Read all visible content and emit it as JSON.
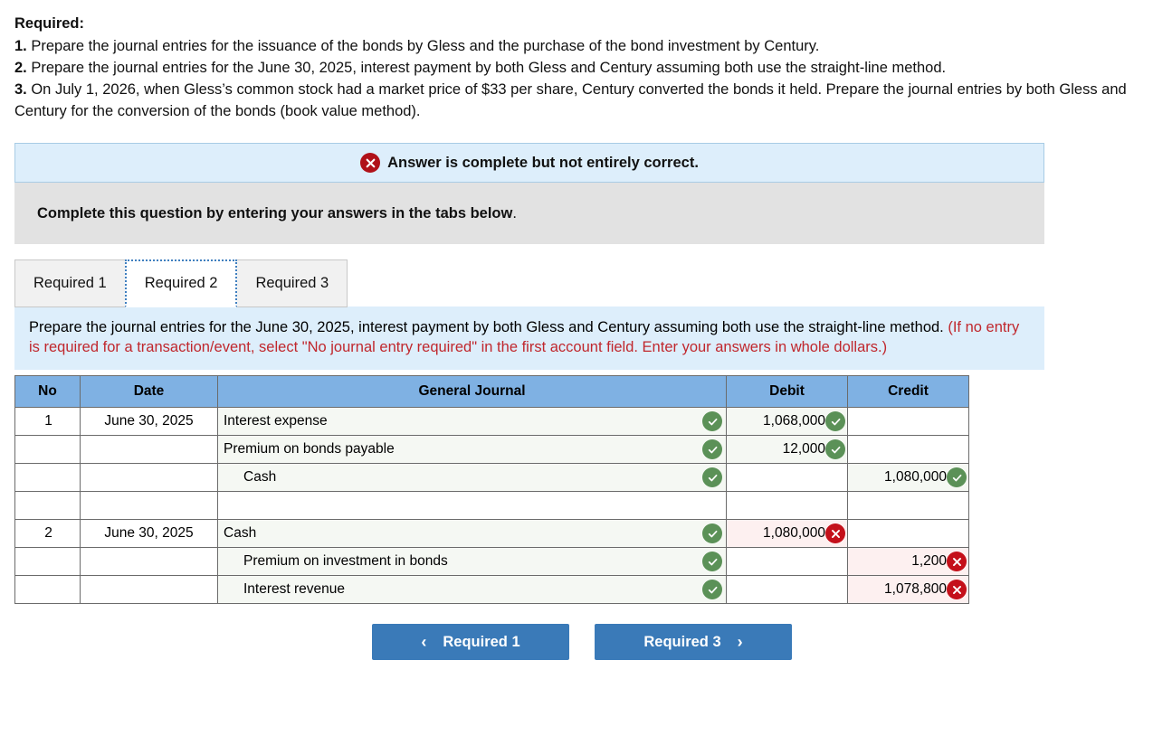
{
  "required_block": {
    "title": "Required:",
    "items": [
      {
        "num": "1.",
        "text": " Prepare the journal entries for the issuance of the bonds by Gless and the purchase of the bond investment by Century."
      },
      {
        "num": "2.",
        "text": " Prepare the journal entries for the June 30, 2025, interest payment by both Gless and Century assuming both use the straight-line method."
      },
      {
        "num": "3.",
        "text": " On July 1, 2026, when Gless’s common stock had a market price of $33 per share, Century converted the bonds it held. Prepare the journal entries by both Gless and Century for the conversion of the bonds (book value method)."
      }
    ]
  },
  "alert": {
    "icon": "x-circle-icon",
    "text": "Answer is complete but not entirely correct.",
    "background": "#ddeefb",
    "border": "#a8cce5"
  },
  "gray_banner": {
    "bold_text": "Complete this question by entering your answers in the tabs below",
    "tail_text": "."
  },
  "tabs": [
    {
      "label": "Required 1",
      "active": false
    },
    {
      "label": "Required 2",
      "active": true
    },
    {
      "label": "Required 3",
      "active": false
    }
  ],
  "instruction": {
    "black_text": "Prepare the journal entries for the June 30, 2025, interest payment by both Gless and Century assuming both use the straight-line method. ",
    "red_text": "(If no entry is required for a transaction/event, select \"No journal entry required\" in the first account field. Enter your answers in whole dollars.)",
    "red_color": "#c0272d"
  },
  "table": {
    "headers": [
      "No",
      "Date",
      "General Journal",
      "Debit",
      "Credit"
    ],
    "header_background": "#7fb1e3",
    "rows": [
      {
        "no": "1",
        "date": "June 30, 2025",
        "account": "Interest expense",
        "indent": false,
        "account_status": "ok",
        "debit": "1,068,000",
        "debit_status": "ok",
        "credit": "",
        "credit_status": ""
      },
      {
        "no": "",
        "date": "",
        "account": "Premium on bonds payable",
        "indent": false,
        "account_status": "ok",
        "debit": "12,000",
        "debit_status": "ok",
        "credit": "",
        "credit_status": ""
      },
      {
        "no": "",
        "date": "",
        "account": "Cash",
        "indent": true,
        "account_status": "ok",
        "debit": "",
        "debit_status": "",
        "credit": "1,080,000",
        "credit_status": "ok"
      },
      {
        "no": "",
        "date": "",
        "account": "",
        "indent": false,
        "account_status": "",
        "debit": "",
        "debit_status": "",
        "credit": "",
        "credit_status": ""
      },
      {
        "no": "2",
        "date": "June 30, 2025",
        "account": "Cash",
        "indent": false,
        "account_status": "ok",
        "debit": "1,080,000",
        "debit_status": "bad",
        "credit": "",
        "credit_status": ""
      },
      {
        "no": "",
        "date": "",
        "account": "Premium on investment in bonds",
        "indent": true,
        "account_status": "ok",
        "debit": "",
        "debit_status": "",
        "credit": "1,200",
        "credit_status": "bad"
      },
      {
        "no": "",
        "date": "",
        "account": "Interest revenue",
        "indent": true,
        "account_status": "ok",
        "debit": "",
        "debit_status": "",
        "credit": "1,078,800",
        "credit_status": "bad"
      }
    ],
    "status_colors": {
      "ok": "#5b9157",
      "bad": "#c4101a"
    }
  },
  "nav": {
    "prev": {
      "label": "Required 1",
      "chevron": "chevron-left-icon",
      "glyph": "‹"
    },
    "next": {
      "label": "Required 3",
      "chevron": "chevron-right-icon",
      "glyph": "›"
    },
    "color": "#3a7ab8"
  }
}
